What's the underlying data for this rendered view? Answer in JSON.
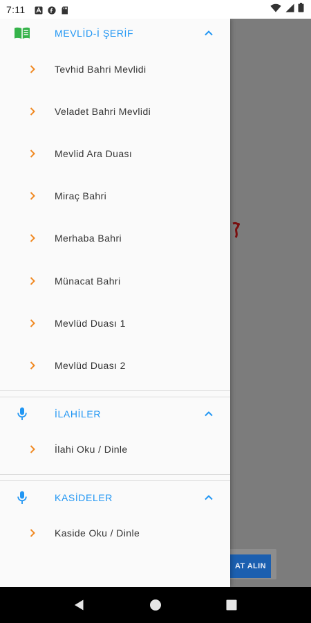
{
  "status_bar": {
    "time": "7:11",
    "left_icons": [
      "a-icon",
      "f-icon",
      "sd-card-icon"
    ],
    "right_icons": [
      "wifi-icon",
      "signal-icon",
      "battery-icon"
    ]
  },
  "background": {
    "glyph_text": "ece",
    "button_label": "AT ALIN"
  },
  "drawer": {
    "sections": [
      {
        "title": "MEVLİD-İ ŞERİF",
        "icon": "book-icon",
        "expanded": true,
        "items": [
          {
            "label": "Tevhid Bahri Mevlidi"
          },
          {
            "label": "Veladet Bahri Mevlidi"
          },
          {
            "label": "Mevlid Ara Duası"
          },
          {
            "label": "Miraç Bahri"
          },
          {
            "label": "Merhaba Bahri"
          },
          {
            "label": "Münacat Bahri"
          },
          {
            "label": "Mevlüd Duası 1"
          },
          {
            "label": "Mevlüd Duası 2"
          }
        ]
      },
      {
        "title": "İLAHİLER",
        "icon": "microphone-icon",
        "expanded": true,
        "items": [
          {
            "label": "İlahi Oku / Dinle"
          }
        ]
      },
      {
        "title": "KASİDELER",
        "icon": "microphone-icon",
        "expanded": true,
        "items": [
          {
            "label": "Kaside Oku / Dinle"
          }
        ]
      }
    ]
  },
  "nav_bar": {
    "buttons": [
      "back-icon",
      "home-icon",
      "recents-icon"
    ]
  },
  "colors": {
    "accent": "#2196f3",
    "chevron": "#f08a24",
    "book_green": "#35b34a",
    "drawer_bg": "#fafafa",
    "scrim": "#7a7a7a"
  }
}
